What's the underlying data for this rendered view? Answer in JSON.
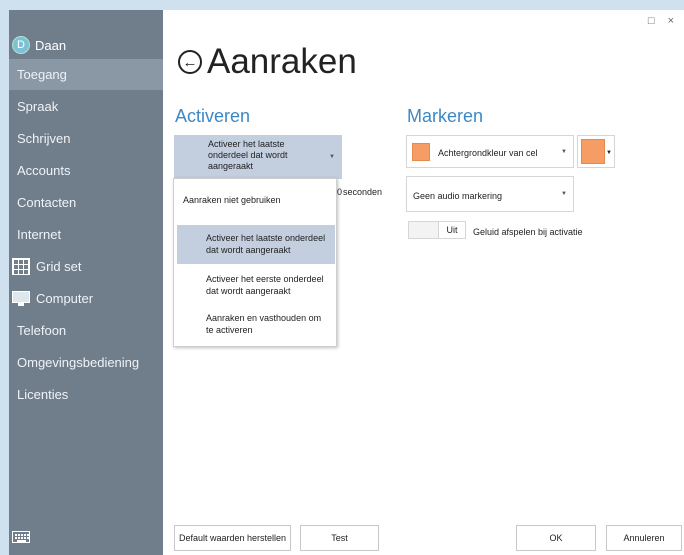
{
  "sidebar": {
    "user": {
      "initial": "D",
      "name": "Daan"
    },
    "items": [
      {
        "label": "Toegang",
        "active": true
      },
      {
        "label": "Spraak"
      },
      {
        "label": "Schrijven"
      },
      {
        "label": "Accounts"
      },
      {
        "label": "Contacten"
      },
      {
        "label": "Internet"
      },
      {
        "label": "Grid set",
        "icon": "grid-icon"
      },
      {
        "label": "Computer",
        "icon": "computer-icon"
      },
      {
        "label": "Telefoon"
      },
      {
        "label": "Omgevingsbediening"
      },
      {
        "label": "Licenties"
      }
    ],
    "keyboard_icon": "keyboard-icon"
  },
  "window": {
    "maximize_glyph": "□",
    "close_glyph": "×"
  },
  "page": {
    "title": "Aanraken",
    "back_glyph": "←"
  },
  "activeren": {
    "heading": "Activeren",
    "selected_line1": "Activeer het laatste",
    "selected_line2": "onderdeel dat wordt",
    "selected_line3": "aangeraakt",
    "seconds_label": "seconden",
    "seconds_digit": "0",
    "menu": {
      "opt1": "Aanraken niet gebruiken",
      "opt2_line1": "Activeer het laatste onderdeel",
      "opt2_line2": "dat wordt aangeraakt",
      "opt3_line1": "Activeer het eerste onderdeel",
      "opt3_line2": "dat wordt aangeraakt",
      "opt4_line1": "Aanraken en vasthouden om",
      "opt4_line2": "te activeren"
    }
  },
  "markeren": {
    "heading": "Markeren",
    "background_label": "Achtergrondkleur van cel",
    "color": "#f59d64",
    "audio_label": "Geen audio markering",
    "toggle_label": "Uit",
    "sound_label": "Geluid afspelen bij activatie"
  },
  "footer": {
    "reset": "Default waarden herstellen",
    "test": "Test",
    "ok": "OK",
    "cancel": "Annuleren"
  }
}
